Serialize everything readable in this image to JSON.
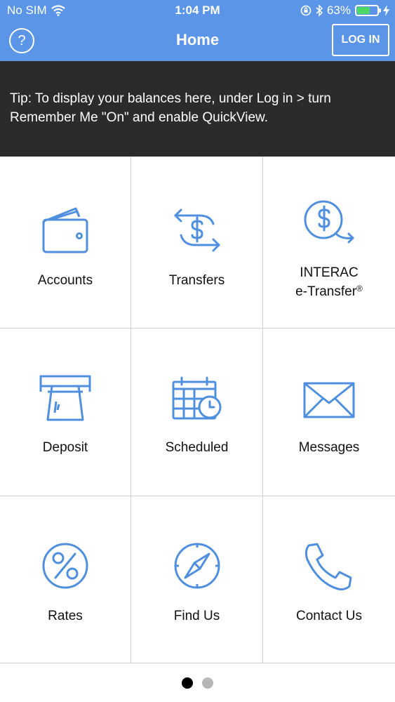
{
  "status_bar": {
    "carrier": "No SIM",
    "time": "1:04 PM",
    "battery_percent": "63%",
    "battery_level": 0.63,
    "icons": [
      "wifi-icon",
      "orientation-lock-icon",
      "bluetooth-icon",
      "battery-icon",
      "charging-bolt-icon"
    ]
  },
  "nav": {
    "help_label": "?",
    "title": "Home",
    "login_label": "LOG IN"
  },
  "tip": {
    "text": "Tip: To display your balances here, under Log in > turn Remember Me \"On\" and enable QuickView."
  },
  "tiles": {
    "accounts": "Accounts",
    "transfers": "Transfers",
    "interac_line1": "INTERAC",
    "interac_line2": "e-Transfer",
    "interac_mark": "®",
    "deposit": "Deposit",
    "scheduled": "Scheduled",
    "messages": "Messages",
    "rates": "Rates",
    "find_us": "Find Us",
    "contact_us": "Contact Us"
  },
  "pager": {
    "current_page": 1,
    "total_pages": 2
  },
  "colors": {
    "header_blue": "#5b95e8",
    "icon_blue": "#4f8fe0",
    "tip_background": "#2b2b2b",
    "battery_green": "#4cd964"
  }
}
